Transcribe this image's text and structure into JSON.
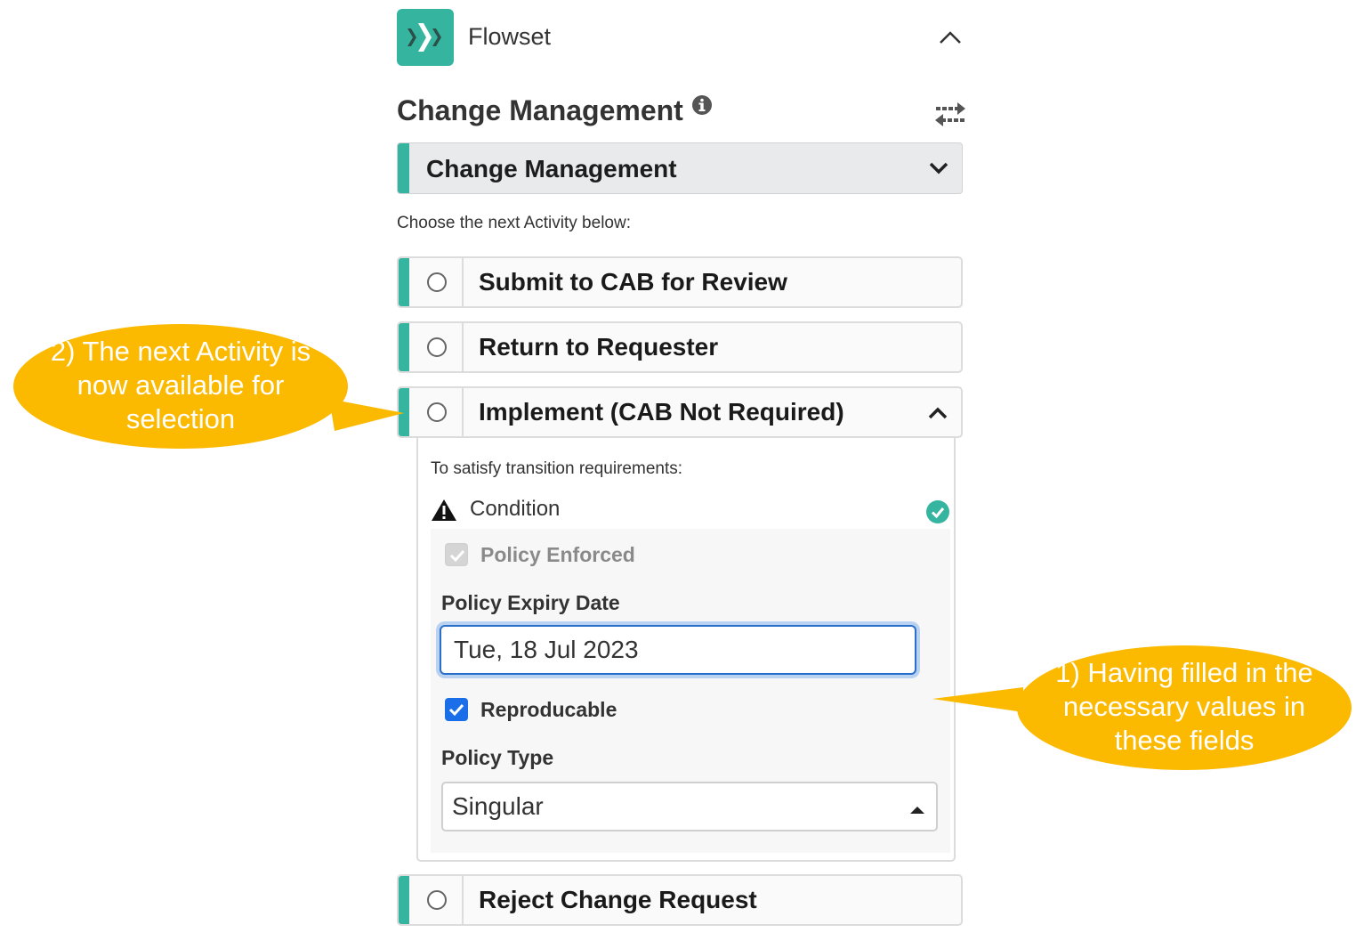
{
  "header": {
    "app_title": "Flowset"
  },
  "section": {
    "title": "Change Management"
  },
  "workflow_select": {
    "value": "Change Management"
  },
  "hint": "Choose the next Activity below:",
  "activities": [
    {
      "label": "Submit to CAB for Review"
    },
    {
      "label": "Return to Requester"
    },
    {
      "label": "Implement (CAB Not Required)"
    },
    {
      "label": "Reject Change Request"
    }
  ],
  "panel": {
    "requirements_text": "To satisfy transition requirements:",
    "condition_label": "Condition",
    "policy_enforced_label": "Policy Enforced",
    "policy_expiry_label": "Policy Expiry Date",
    "policy_expiry_value": "Tue, 18 Jul 2023",
    "reproducable_label": "Reproducable",
    "policy_type_label": "Policy Type",
    "policy_type_value": "Singular"
  },
  "callouts": {
    "left": [
      "2) The next Activity is",
      "now available for",
      "selection"
    ],
    "right": [
      "1) Having filled in the",
      "necessary values in",
      "these fields"
    ]
  },
  "colors": {
    "accent": "#35b59f",
    "callout": "#fbb900",
    "checkbox": "#1a6fe8",
    "focus": "#2a6fc9"
  }
}
